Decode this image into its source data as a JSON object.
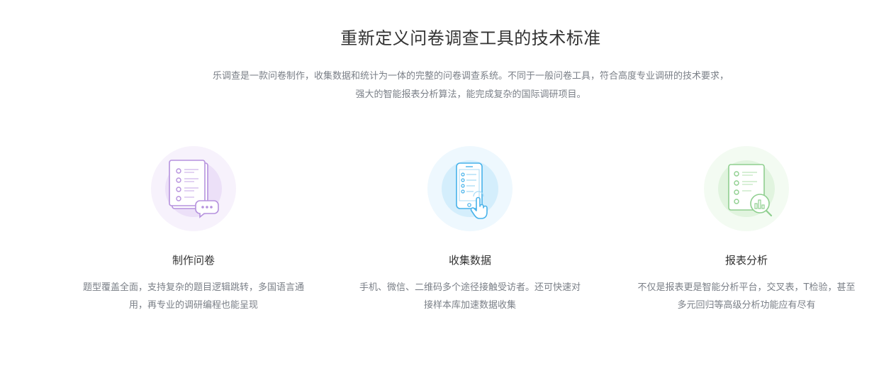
{
  "heading": {
    "title": "重新定义问卷调查工具的技术标准",
    "intro": "乐调查是一款问卷制作，收集数据和统计为一体的完整的问卷调查系统。不同于一般问卷工具，符合高度专业调研的技术要求，强大的智能报表分析算法，能完成复杂的国际调研项目。"
  },
  "features": [
    {
      "icon": "questionnaire-chat-icon",
      "name": "制作问卷",
      "desc": "题型覆盖全面，支持复杂的题目逻辑跳转，多国语言通用，再专业的调研编程也能呈现",
      "color": "#b38fdc"
    },
    {
      "icon": "phone-tap-icon",
      "name": "收集数据",
      "desc": "手机、微信、二维码多个途径接触受访者。还可快速对接样本库加速数据收集",
      "color": "#49b8ec"
    },
    {
      "icon": "report-magnifier-icon",
      "name": "报表分析",
      "desc": "不仅是报表更是智能分析平台，交叉表，T检验，甚至多元回归等高级分析功能应有尽有",
      "color": "#8fd08f"
    }
  ]
}
